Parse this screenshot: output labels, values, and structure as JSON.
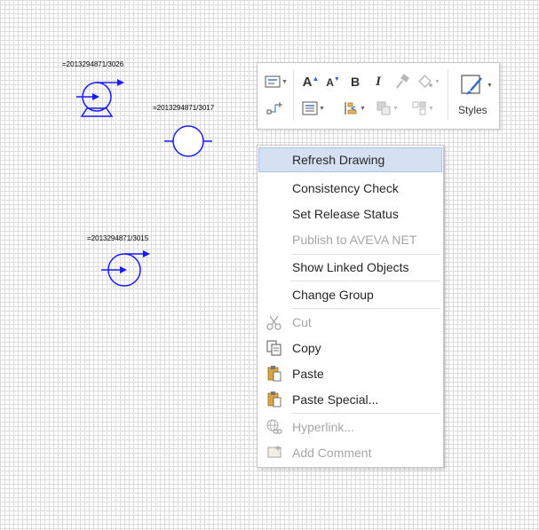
{
  "canvas": {
    "tags": {
      "pump": "=2013294871/3026",
      "valve": "=2013294871/3017",
      "fan": "=2013294871/3015"
    }
  },
  "toolbar": {
    "styles_label": "Styles",
    "icons": [
      "text-box-icon",
      "connector-icon",
      "grow-font-icon",
      "shrink-font-icon",
      "bold-icon",
      "italic-icon",
      "format-painter-icon",
      "shape-fill-icon",
      "align-icon",
      "position-icon",
      "bring-forward-icon",
      "send-backward-icon",
      "styles-icon"
    ],
    "bold": "B",
    "italic": "I",
    "grow": "A",
    "shrink": "A"
  },
  "menu": {
    "items": [
      {
        "label": "Refresh Drawing",
        "enabled": true,
        "highlighted": true
      },
      {
        "label": "Consistency Check",
        "enabled": true
      },
      {
        "label": "Set Release Status",
        "enabled": true
      },
      {
        "label": "Publish to AVEVA NET",
        "enabled": false
      },
      {
        "label": "Show Linked Objects",
        "enabled": true
      },
      {
        "label": "Change Group",
        "enabled": true
      },
      {
        "label": "Cut",
        "enabled": false,
        "icon": "scissors-icon"
      },
      {
        "label": "Copy",
        "enabled": true,
        "icon": "copy-icon"
      },
      {
        "label": "Paste",
        "enabled": true,
        "icon": "paste-icon"
      },
      {
        "label": "Paste Special...",
        "enabled": true,
        "icon": "paste-special-icon"
      },
      {
        "label": "Hyperlink...",
        "enabled": false,
        "icon": "hyperlink-icon"
      },
      {
        "label": "Add Comment",
        "enabled": false,
        "icon": "comment-icon"
      }
    ]
  },
  "colors": {
    "symbol": "#1a1aff",
    "highlight": "#d5e1f2",
    "disabled": "#a6a6a6",
    "paste_icon": "#d9a441"
  }
}
